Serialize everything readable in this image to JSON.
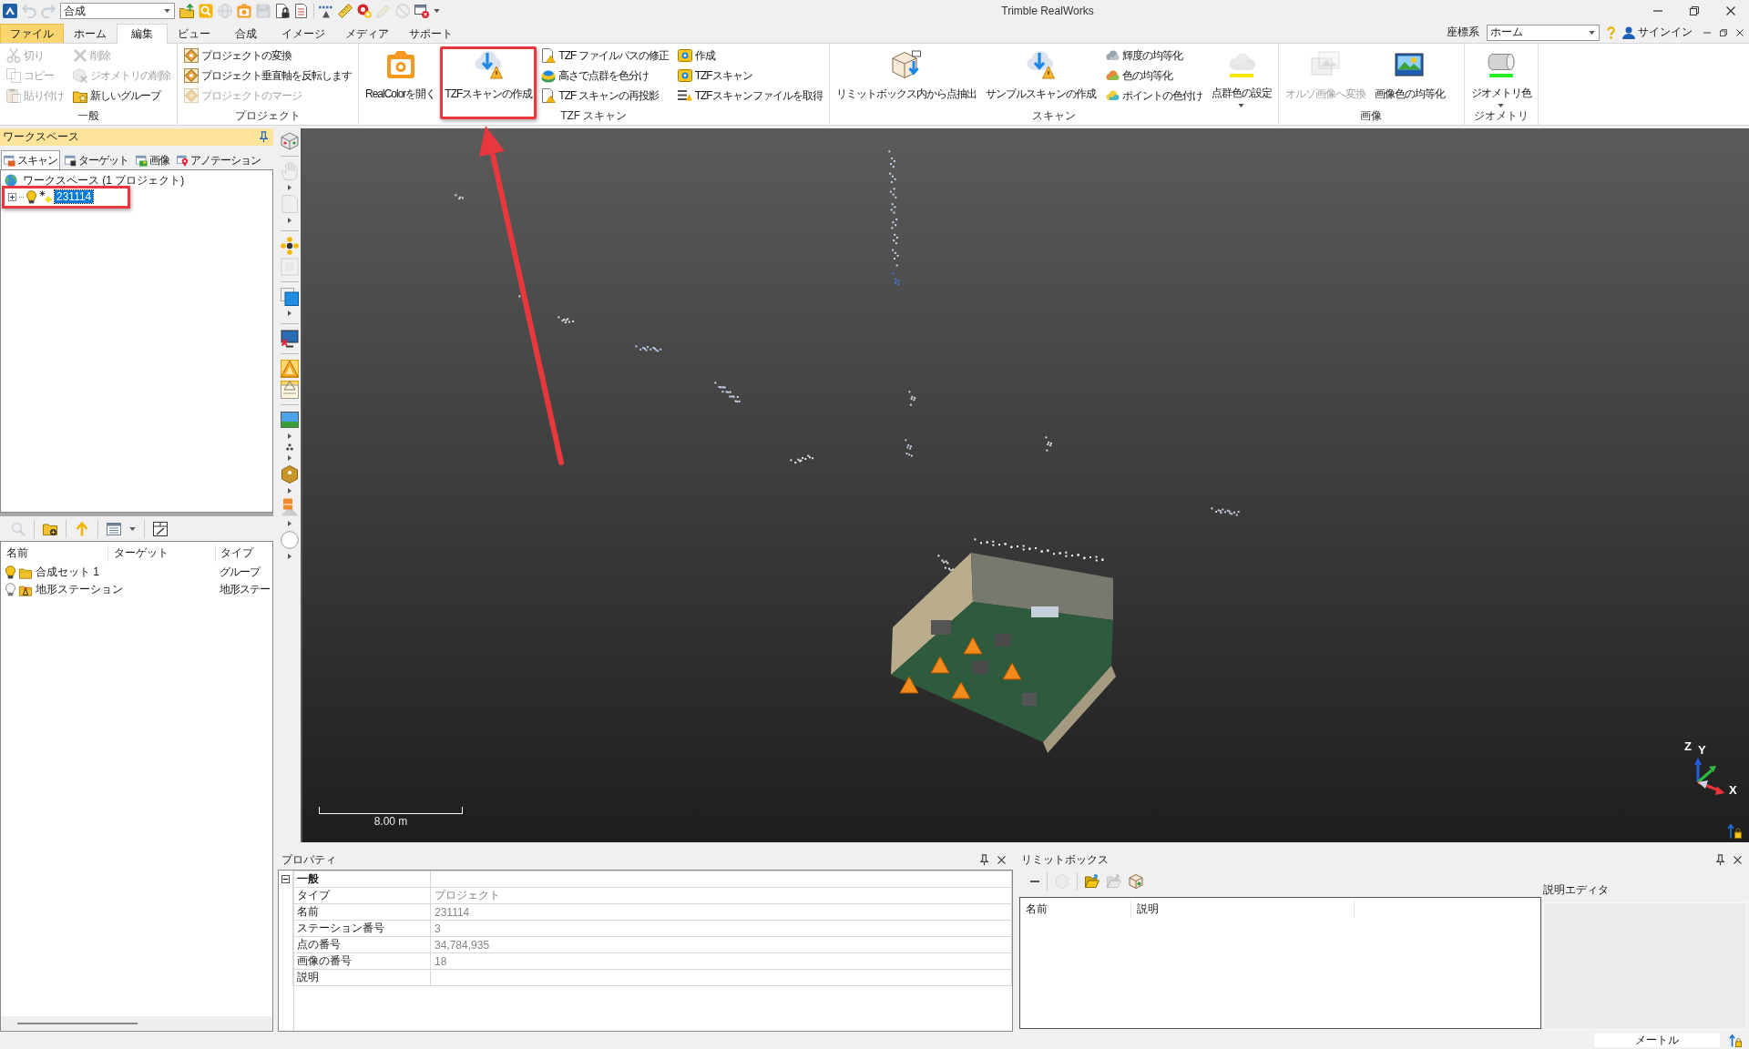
{
  "window": {
    "title": "Trimble RealWorks"
  },
  "quick_access": {
    "history": [
      {
        "disabled": true
      },
      {
        "disabled": true
      }
    ],
    "combo": {
      "value": "合成"
    },
    "buttons": [
      {
        "disabled": false
      },
      {
        "disabled": false
      },
      {
        "disabled": true
      },
      {
        "disabled": false
      },
      {
        "disabled": true
      },
      {
        "disabled": false
      },
      {
        "disabled": false
      },
      {
        "disabled": false
      },
      {
        "disabled": false
      },
      {
        "disabled": false
      },
      {
        "disabled": true
      },
      {
        "disabled": true
      },
      {
        "disabled": false
      }
    ]
  },
  "menu_tabs": [
    {
      "label": "ファイル",
      "kind": "file",
      "selected": false
    },
    {
      "label": "ホーム",
      "kind": "tab",
      "selected": false
    },
    {
      "label": "編集",
      "kind": "tab",
      "selected": true
    },
    {
      "label": "ビュー",
      "kind": "tab",
      "selected": false
    },
    {
      "label": "合成",
      "kind": "tab",
      "selected": false
    },
    {
      "label": "イメージ",
      "kind": "tab",
      "selected": false
    },
    {
      "label": "メディア",
      "kind": "tab",
      "selected": false
    },
    {
      "label": "サポート",
      "kind": "tab",
      "selected": false
    }
  ],
  "coordinate_system": {
    "label": "座標系",
    "value": "ホーム"
  },
  "account": {
    "label": "サインイン"
  },
  "ribbon": {
    "groups": [
      {
        "title": "一般",
        "items": [
          {
            "kind": "small",
            "label": "切り",
            "disabled": true,
            "highlighted": false
          },
          {
            "kind": "small",
            "label": "コピー",
            "disabled": true,
            "highlighted": false
          },
          {
            "kind": "small",
            "label": "貼り付け",
            "disabled": true,
            "highlighted": false
          },
          {
            "kind": "small",
            "label": "削除",
            "disabled": true,
            "highlighted": false
          },
          {
            "kind": "small",
            "label": "ジオメトリの削除",
            "disabled": true,
            "highlighted": false
          },
          {
            "kind": "small",
            "label": "新しいグループ",
            "disabled": false,
            "highlighted": false
          }
        ]
      },
      {
        "title": "プロジェクト",
        "items": [
          {
            "kind": "small",
            "label": "プロジェクトの変換",
            "disabled": false,
            "highlighted": false
          },
          {
            "kind": "small",
            "label": "プロジェクト垂直軸を反転します",
            "disabled": false,
            "highlighted": false
          },
          {
            "kind": "small",
            "label": "プロジェクトのマージ",
            "disabled": true,
            "highlighted": false
          }
        ]
      },
      {
        "title": "TZF スキャン",
        "items": [
          {
            "kind": "large",
            "label": "RealColorを開く",
            "disabled": false,
            "highlighted": false
          },
          {
            "kind": "large",
            "label": "TZFスキャンの作成",
            "disabled": false,
            "highlighted": true
          },
          {
            "kind": "small",
            "label": "TZF ファイルパスの修正",
            "disabled": false,
            "highlighted": false
          },
          {
            "kind": "small",
            "label": "高さで点群を色分け",
            "disabled": false,
            "highlighted": false
          },
          {
            "kind": "small",
            "label": "TZF スキャンの再投影",
            "disabled": false,
            "highlighted": false
          },
          {
            "kind": "small",
            "label": "作成",
            "disabled": false,
            "highlighted": false
          },
          {
            "kind": "small",
            "label": "TZFスキャン",
            "disabled": false,
            "highlighted": false
          },
          {
            "kind": "small",
            "label": "TZFスキャンファイルを取得",
            "disabled": false,
            "highlighted": false
          }
        ]
      },
      {
        "title": "スキャン",
        "items": [
          {
            "kind": "large",
            "label": "リミットボックス内から点抽出",
            "disabled": false,
            "highlighted": false
          },
          {
            "kind": "large",
            "label": "サンプルスキャンの作成",
            "disabled": false,
            "highlighted": false
          },
          {
            "kind": "small",
            "label": "輝度の均等化",
            "disabled": false,
            "highlighted": false
          },
          {
            "kind": "small",
            "label": "色の均等化",
            "disabled": false,
            "highlighted": false
          },
          {
            "kind": "small",
            "label": "ポイントの色付け",
            "disabled": false,
            "highlighted": false
          },
          {
            "kind": "swatch",
            "label": "点群色の設定",
            "color": "#ffe400",
            "disabled": false,
            "highlighted": false
          }
        ]
      },
      {
        "title": "画像",
        "items": [
          {
            "kind": "large",
            "label": "オルソ画像へ変換",
            "disabled": true,
            "highlighted": false
          },
          {
            "kind": "large",
            "label": "画像色の均等化",
            "disabled": false,
            "highlighted": false
          }
        ]
      },
      {
        "title": "ジオメトリ",
        "items": [
          {
            "kind": "swatch",
            "label": "ジオメトリ色",
            "color": "#22f022",
            "disabled": false,
            "highlighted": false
          }
        ]
      }
    ]
  },
  "workspace": {
    "title": "ワークスペース",
    "tabs": [
      {
        "label": "スキャン",
        "selected": true
      },
      {
        "label": "ターゲット",
        "selected": false
      },
      {
        "label": "画像",
        "selected": false
      },
      {
        "label": "アノテーション",
        "selected": false
      }
    ],
    "tree": [
      {
        "label": "ワークスペース (1 プロジェクト)",
        "selected": false,
        "highlighted": false,
        "children": [
          {
            "label": "231114",
            "expanded": false,
            "visible": true,
            "selected": true,
            "highlighted": true
          }
        ]
      }
    ]
  },
  "object_list": {
    "toolbar": [
      {
        "disabled": true
      },
      {
        "disabled": false
      },
      {
        "disabled": false
      },
      {
        "disabled": false
      },
      {
        "disabled": false
      }
    ],
    "columns": [
      "名前",
      "ターゲット",
      "タイプ"
    ],
    "rows": [
      {
        "kind": "group",
        "visible": true,
        "name": "合成セット 1",
        "type": "グループ"
      },
      {
        "kind": "station",
        "visible": false,
        "name": "地形ステーション",
        "type": "地形ステー"
      }
    ]
  },
  "view_toolbar": [
    {
      "disabled": false,
      "on": false
    },
    {
      "disabled": true,
      "on": false
    },
    {
      "disabled": true,
      "on": false
    },
    {
      "disabled": false,
      "on": false
    },
    {
      "disabled": true,
      "on": false
    },
    {
      "disabled": false,
      "on": false
    },
    {
      "disabled": false,
      "on": false
    },
    {
      "disabled": false,
      "on": true
    },
    {
      "disabled": false,
      "on": true
    },
    {
      "disabled": false,
      "on": false
    },
    {
      "disabled": false,
      "on": false
    },
    {
      "disabled": false,
      "on": false
    },
    {
      "disabled": false,
      "on": false
    },
    {
      "disabled": false,
      "on": false
    }
  ],
  "viewport": {
    "scale_label": "8.00 m",
    "axes": {
      "z": "Z",
      "y": "Y",
      "x": "X"
    }
  },
  "properties": {
    "title": "プロパティ",
    "section": {
      "title": "一般",
      "expanded": true,
      "rows": [
        {
          "name": "タイプ",
          "value": "プロジェクト"
        },
        {
          "name": "名前",
          "value": "231114"
        },
        {
          "name": "ステーション番号",
          "value": "3"
        },
        {
          "name": "点の番号",
          "value": "34,784,935"
        },
        {
          "name": "画像の番号",
          "value": "18"
        },
        {
          "name": "説明"
        }
      ]
    }
  },
  "limit_box": {
    "title": "リミットボックス",
    "toolbar": [
      {
        "disabled": false
      },
      {
        "disabled": true
      },
      {
        "disabled": false
      },
      {
        "disabled": true
      },
      {
        "disabled": false
      }
    ],
    "columns": [
      "名前",
      "説明"
    ],
    "editor_label": "説明エディタ"
  },
  "status_bar": {
    "unit": "メートル"
  },
  "annotation": {
    "arrow": true
  }
}
